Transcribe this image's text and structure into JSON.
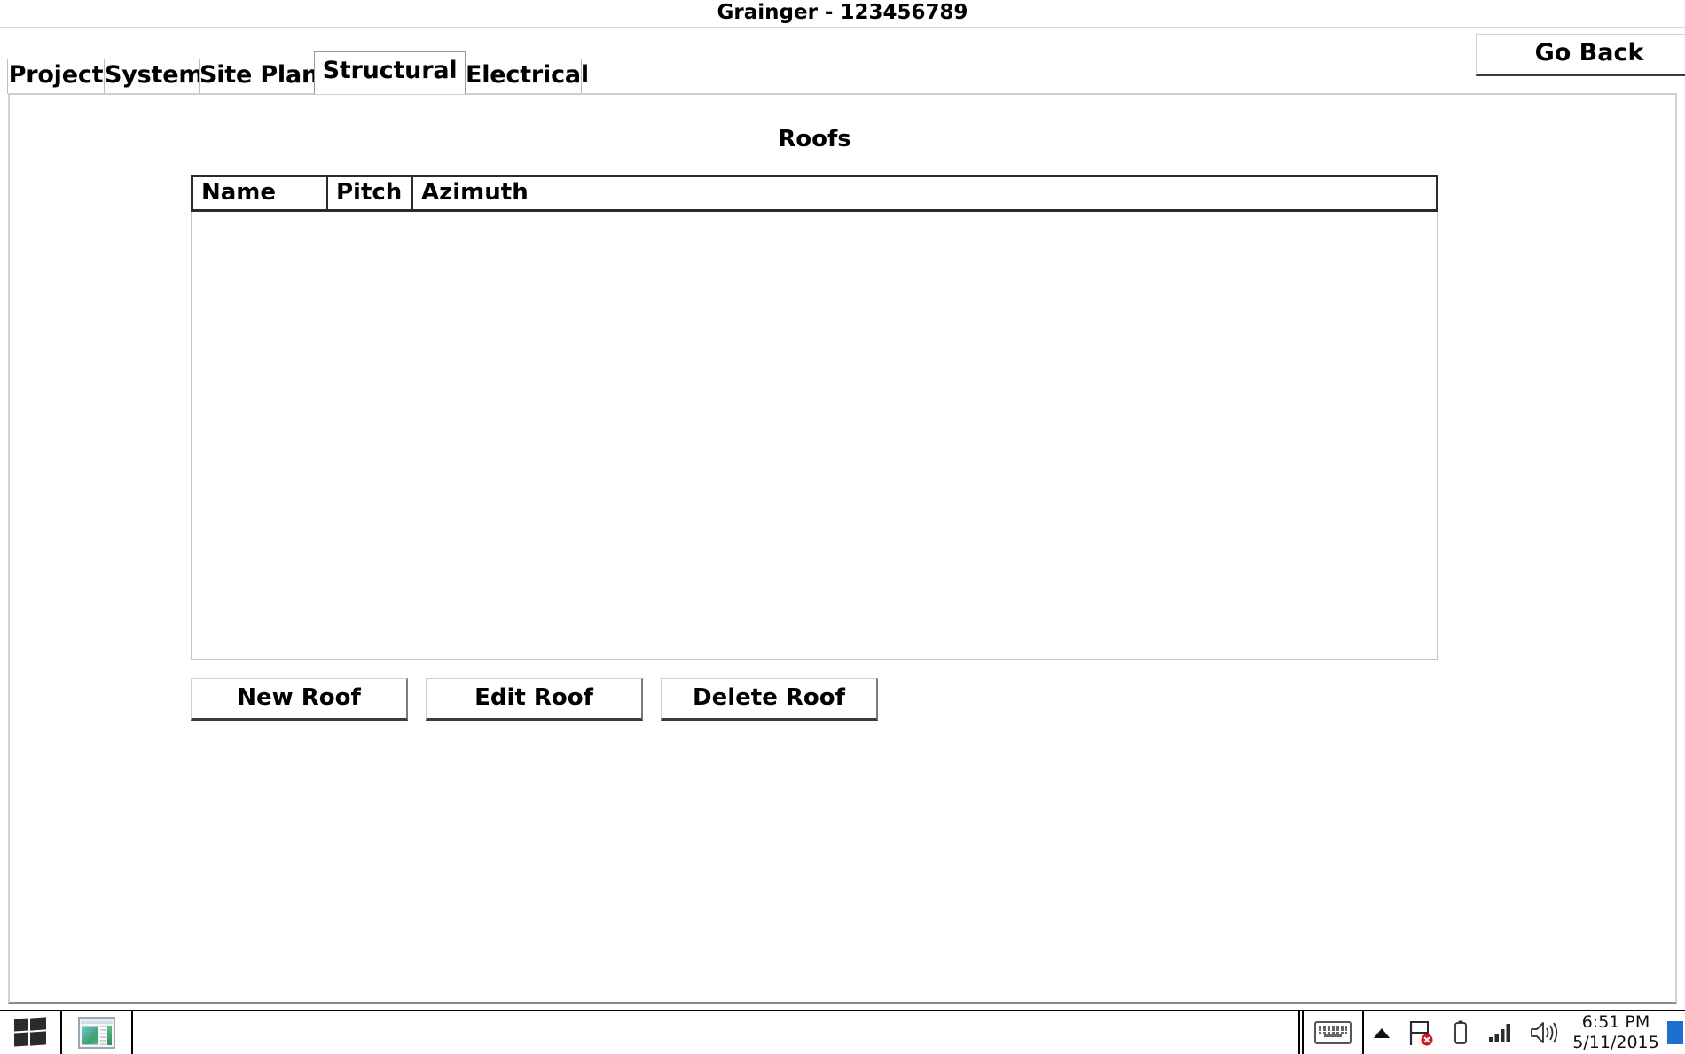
{
  "window": {
    "title": "Grainger - 123456789"
  },
  "go_back": {
    "label": "Go Back"
  },
  "tabs": [
    {
      "label": "Project",
      "active": false
    },
    {
      "label": "System",
      "active": false
    },
    {
      "label": "Site Plan",
      "active": false
    },
    {
      "label": "Structural",
      "active": true
    },
    {
      "label": "Electrical",
      "active": false
    }
  ],
  "main": {
    "section_title": "Roofs",
    "table": {
      "columns": [
        "Name",
        "Pitch",
        "Azimuth"
      ],
      "rows": []
    },
    "actions": [
      {
        "label": "New Roof"
      },
      {
        "label": "Edit Roof"
      },
      {
        "label": "Delete Roof"
      }
    ]
  },
  "taskbar": {
    "start_icon": "windows-logo-icon",
    "apps": [
      {
        "icon": "window-app-icon"
      }
    ],
    "tray": {
      "touch_keyboard_icon": "keyboard-icon",
      "show_hidden_icon": "caret-up-icon",
      "action_center_icon": "flag-error-icon",
      "battery_icon": "battery-icon",
      "network_icon": "signal-bars-icon",
      "volume_icon": "speaker-icon",
      "time": "6:51 PM",
      "date": "5/11/2015",
      "notification_icon": "notification-icon"
    }
  },
  "colors": {
    "accent": "#1f6fd0",
    "error": "#d4181f",
    "border_dark": "#2b2b2b",
    "border_light": "#cfcfcf"
  }
}
